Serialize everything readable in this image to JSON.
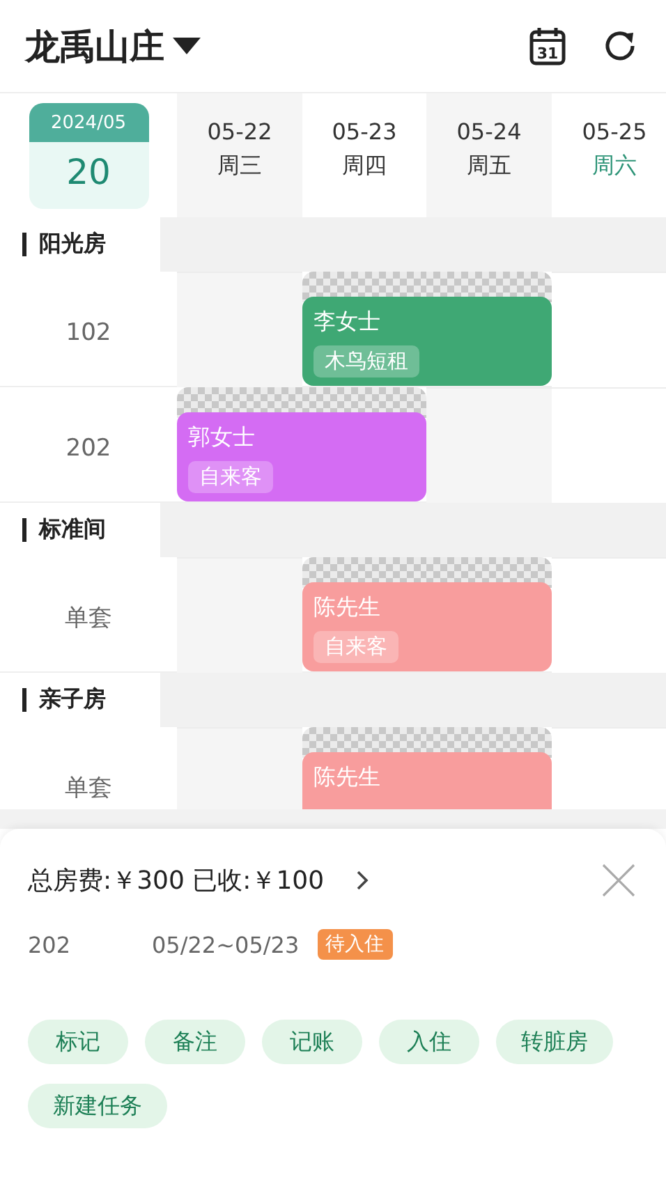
{
  "header": {
    "title": "龙禹山庄",
    "calendar_day": "31"
  },
  "date_badge": {
    "month": "2024/05",
    "day": "20"
  },
  "days": [
    {
      "date": "05-22",
      "weekday": "周三",
      "weekend": false
    },
    {
      "date": "05-23",
      "weekday": "周四",
      "weekend": false
    },
    {
      "date": "05-24",
      "weekday": "周五",
      "weekend": false
    },
    {
      "date": "05-25",
      "weekday": "周六",
      "weekend": true
    }
  ],
  "groups": [
    {
      "name": "阳光房",
      "rooms": [
        {
          "name": "102",
          "booking": {
            "booked_days": [
              false,
              true,
              true,
              false
            ],
            "guest": "李女士",
            "source": "木鸟短租",
            "color": "#3fa874"
          }
        },
        {
          "name": "202",
          "booking": {
            "booked_days": [
              true,
              true,
              false,
              false
            ],
            "guest": "郭女士",
            "source": "自来客",
            "color": "#d46cf3"
          }
        }
      ]
    },
    {
      "name": "标准间",
      "rooms": [
        {
          "name": "单套",
          "booking": {
            "booked_days": [
              false,
              true,
              true,
              false
            ],
            "guest": "陈先生",
            "source": "自来客",
            "color": "#f89d9d"
          }
        }
      ]
    },
    {
      "name": "亲子房",
      "rooms": [
        {
          "name": "单套",
          "booking": {
            "booked_days": [
              false,
              true,
              true,
              false
            ],
            "guest": "陈先生",
            "color": "#f89d9d"
          }
        }
      ]
    }
  ],
  "sheet": {
    "fee": "总房费:￥300 已收:￥100",
    "room": "202",
    "dates": "05/22~05/23",
    "status": "待入住",
    "actions": [
      "标记",
      "备注",
      "记账",
      "入住",
      "转脏房",
      "新建任务"
    ]
  }
}
